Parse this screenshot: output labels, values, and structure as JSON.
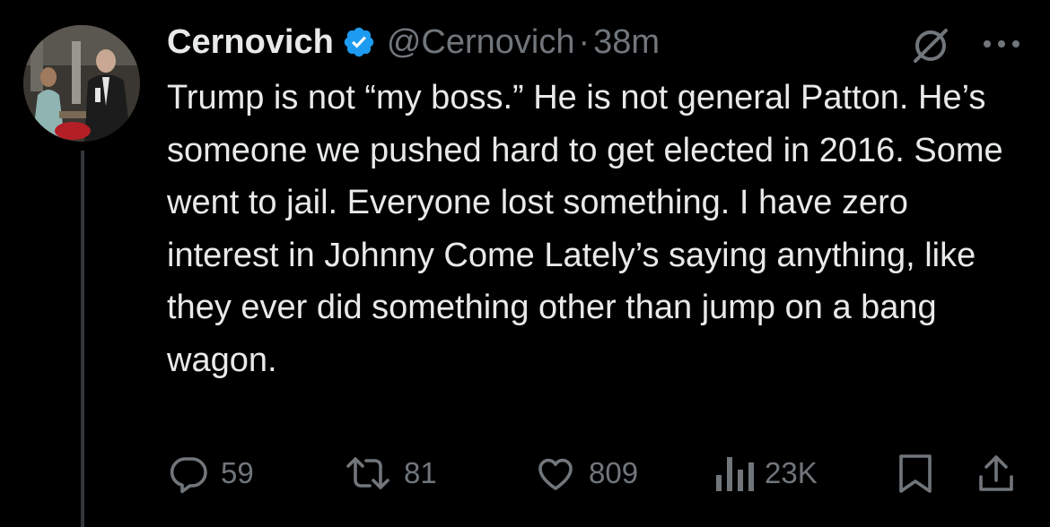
{
  "tweet": {
    "author": {
      "display_name": "Cernovich",
      "handle": "@Cernovich",
      "verified": true
    },
    "separator": "·",
    "timestamp": "38m",
    "text": "Trump is not “my boss.” He is not general Patton. He’s someone we pushed hard to get elected in 2016. Some went to jail. Everyone lost something. I have zero interest in Johnny Come Lately’s saying anything, like they ever did something other than jump on a bang wagon.",
    "actions": {
      "replies": "59",
      "reposts": "81",
      "likes": "809",
      "views": "23K"
    }
  },
  "colors": {
    "background": "#000000",
    "text": "#e7e9ea",
    "muted": "#71767b",
    "verified": "#1d9bf0",
    "thread_line": "#333639"
  },
  "icons": [
    "verified-badge-icon",
    "grok-icon",
    "more-icon",
    "reply-icon",
    "repost-icon",
    "like-icon",
    "views-icon",
    "bookmark-icon",
    "share-icon"
  ]
}
